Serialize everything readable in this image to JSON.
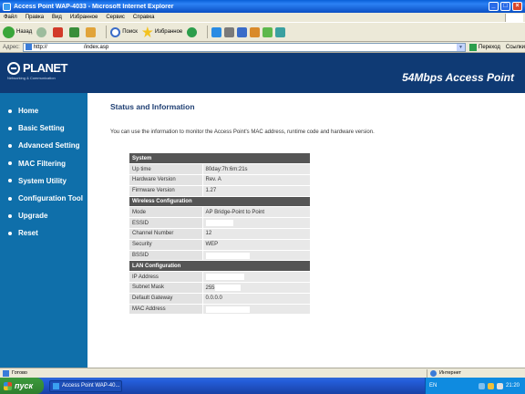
{
  "window": {
    "title": "Access Point WAP-4033 - Microsoft Internet Explorer"
  },
  "menu": [
    "Файл",
    "Правка",
    "Вид",
    "Избранное",
    "Сервис",
    "Справка"
  ],
  "toolbar": {
    "back_label": "Назад",
    "search_label": "Поиск",
    "favorites_label": "Избранное"
  },
  "address": {
    "label": "Адрес:",
    "url_prefix": "http://",
    "url_path": "/index.asp",
    "go_label": "Переход",
    "links_label": "Ссылки"
  },
  "header": {
    "logo_text": "PLANET",
    "tagline": "Networking & Communication",
    "product": "54Mbps Access Point"
  },
  "sidebar": {
    "items": [
      {
        "label": "Home"
      },
      {
        "label": "Basic Setting"
      },
      {
        "label": "Advanced Setting"
      },
      {
        "label": "MAC Filtering"
      },
      {
        "label": "System Utility"
      },
      {
        "label": "Configuration Tool"
      },
      {
        "label": "Upgrade"
      },
      {
        "label": "Reset"
      }
    ]
  },
  "content": {
    "title": "Status and Information",
    "description": "You can use the information to monitor the Access Point's MAC address, runtime code and hardware version."
  },
  "status": {
    "system": {
      "header": "System",
      "rows": [
        {
          "label": "Up time",
          "value": "80day:7h:6m:21s"
        },
        {
          "label": "Hardware Version",
          "value": "Rev. A"
        },
        {
          "label": "Firmware Version",
          "value": "1.27"
        }
      ]
    },
    "wireless": {
      "header": "Wireless Configuration",
      "rows": [
        {
          "label": "Mode",
          "value": "AP Bridge-Point to Point"
        },
        {
          "label": "ESSID",
          "value": ""
        },
        {
          "label": "Channel Number",
          "value": "12"
        },
        {
          "label": "Security",
          "value": "WEP"
        },
        {
          "label": "BSSID",
          "value": ""
        }
      ]
    },
    "lan": {
      "header": "LAN Configuration",
      "rows": [
        {
          "label": "IP Address",
          "value": ""
        },
        {
          "label": "Subnet Mask",
          "value": "255"
        },
        {
          "label": "Default Gateway",
          "value": "0.0.0.0"
        },
        {
          "label": "MAC Address",
          "value": ""
        }
      ]
    }
  },
  "statusbar": {
    "text": "Готово",
    "zone": "Интернет"
  },
  "taskbar": {
    "start": "пуск",
    "task": "Access Point WAP-40...",
    "lang": "EN",
    "clock": "21:20"
  }
}
